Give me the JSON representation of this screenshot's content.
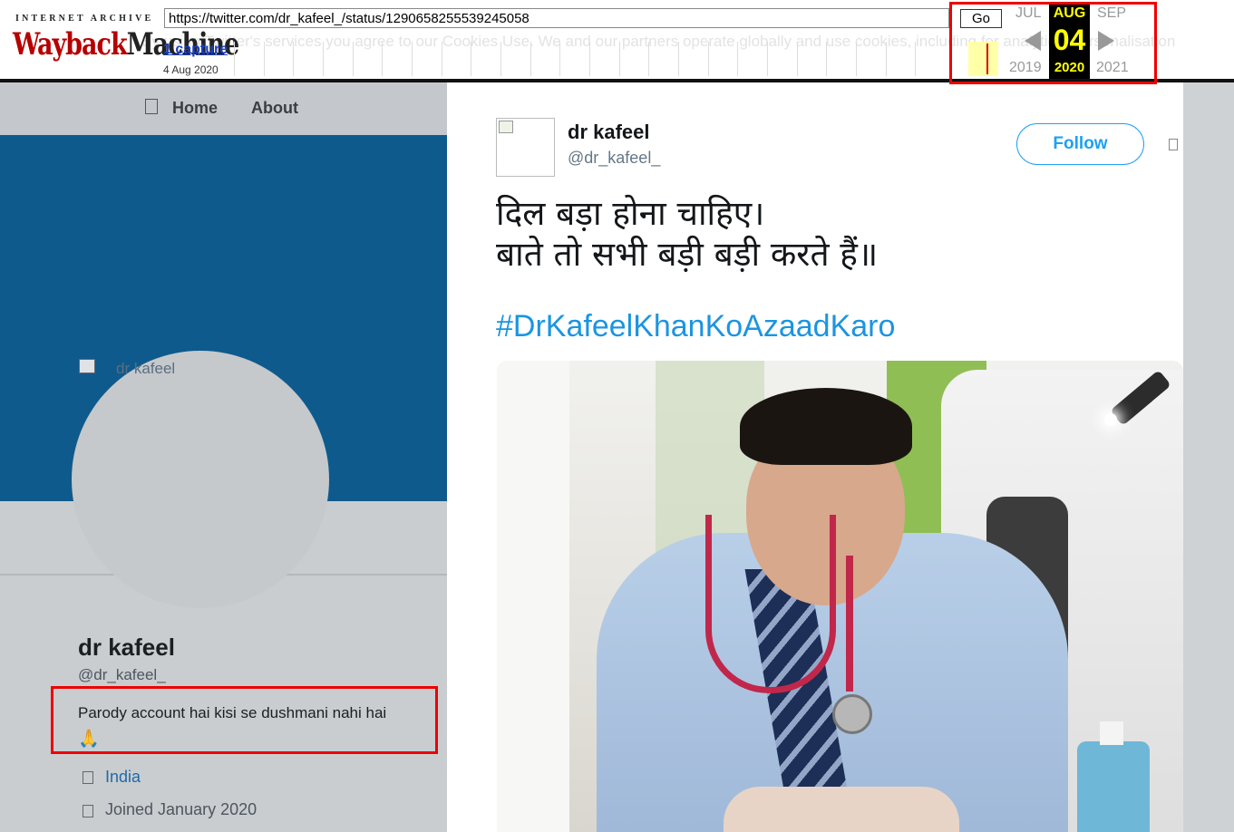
{
  "wayback": {
    "ia_text": "INTERNET ARCHIVE",
    "logo_part1": "Wayback",
    "logo_part2": "Machine",
    "url": "https://twitter.com/dr_kafeel_/status/1290658255539245058",
    "go_label": "Go",
    "captures_link": "1 capture",
    "capture_date": "4 Aug 2020",
    "background_text": "By using Twitter's services you agree to our Cookies Use. We and our partners operate globally and use cookies, including for analytics, personalisation",
    "calendar": {
      "prev_month": "JUL",
      "month": "AUG",
      "next_month": "SEP",
      "day": "04",
      "prev_year": "2019",
      "year": "2020",
      "next_year": "2021"
    }
  },
  "profile": {
    "nav": {
      "home": "Home",
      "about": "About"
    },
    "avatar_alt": "dr kafeel",
    "name": "dr kafeel",
    "handle": "@dr_kafeel_",
    "bio": "Parody account hai kisi se dushmani nahi hai",
    "bio_emoji": "🙏",
    "location": "India",
    "joined": "Joined January 2020"
  },
  "tweet": {
    "author_name": "dr kafeel",
    "author_handle": "@dr_kafeel_",
    "follow_label": "Follow",
    "line1": "दिल बड़ा होना चाहिए।",
    "line2": "बाते तो सभी बड़ी बड़ी करते हैं॥",
    "hashtag": "#DrKafeelKhanKoAzaadKaro"
  },
  "colors": {
    "twitter_blue": "#1da1f2",
    "hashtag_blue": "#1b95e0",
    "highlight_red": "#ee0000",
    "wayback_yellow": "#ffff00",
    "banner_blue": "#0f5a8c"
  },
  "icons": {
    "home": "home-icon",
    "more": "chevron-down-icon",
    "location": "location-pin-icon",
    "calendar": "calendar-icon"
  }
}
